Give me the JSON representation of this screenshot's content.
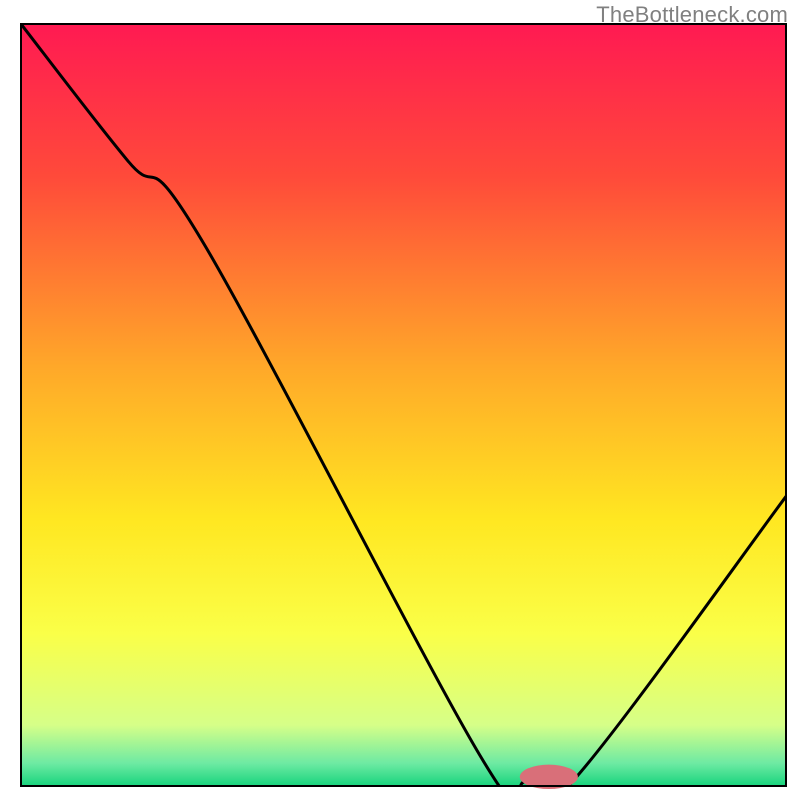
{
  "watermark": "TheBottleneck.com",
  "chart_data": {
    "type": "line",
    "title": "",
    "xlabel": "",
    "ylabel": "",
    "x_range": [
      0,
      100
    ],
    "y_range": [
      0,
      100
    ],
    "gradient_stops": [
      {
        "offset": 0.0,
        "color": "#ff1a52"
      },
      {
        "offset": 0.2,
        "color": "#ff4a3a"
      },
      {
        "offset": 0.45,
        "color": "#ffa829"
      },
      {
        "offset": 0.65,
        "color": "#ffe721"
      },
      {
        "offset": 0.8,
        "color": "#faff48"
      },
      {
        "offset": 0.92,
        "color": "#d6ff88"
      },
      {
        "offset": 0.97,
        "color": "#6eeaa3"
      },
      {
        "offset": 1.0,
        "color": "#18d47d"
      }
    ],
    "series": [
      {
        "name": "bottleneck-curve",
        "x": [
          0,
          14,
          24,
          60,
          66,
          72,
          100
        ],
        "y": [
          100,
          82,
          71,
          4,
          0.5,
          0.5,
          38
        ]
      }
    ],
    "marker": {
      "x": 69,
      "y": 1.2,
      "rx": 3.8,
      "ry": 1.6,
      "color": "#d96f79"
    },
    "axes": {
      "frame": true,
      "frame_color": "#000000",
      "frame_width": 2
    }
  }
}
